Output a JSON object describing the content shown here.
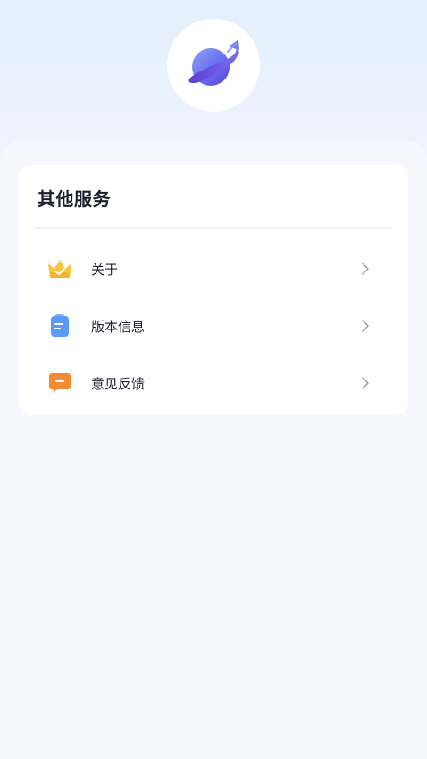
{
  "app": {
    "logo_icon": "planet-icon"
  },
  "services": {
    "title": "其他服务",
    "items": [
      {
        "label": "关于",
        "icon": "crown-icon",
        "icon_color": "#f8c53d"
      },
      {
        "label": "版本信息",
        "icon": "document-icon",
        "icon_color": "#5b9af6"
      },
      {
        "label": "意见反馈",
        "icon": "feedback-icon",
        "icon_color": "#f58a33"
      }
    ]
  },
  "colors": {
    "header_gradient_top": "#e3effd",
    "page_background": "#f7f8fd",
    "planet_primary": "#6a6ef0",
    "chevron": "#9a9ca4"
  }
}
